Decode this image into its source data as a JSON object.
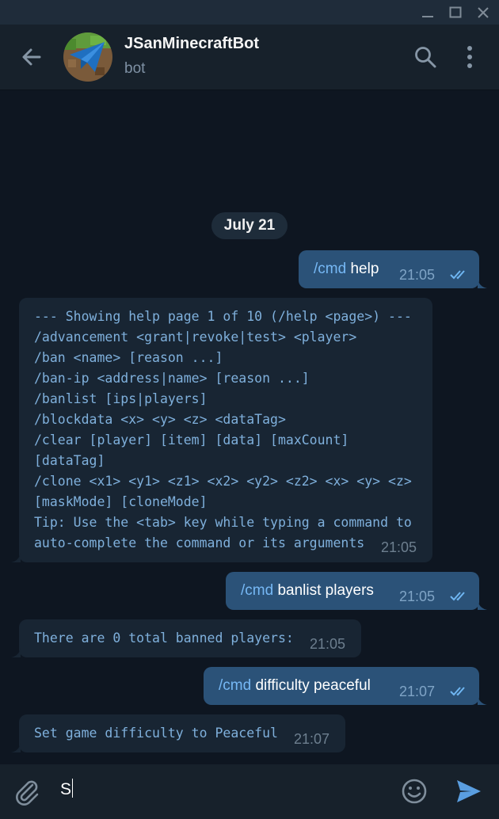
{
  "header": {
    "title": "JSanMinecraftBot",
    "status": "bot"
  },
  "date_separator": "July 21",
  "messages": [
    {
      "direction": "out",
      "command": "/cmd",
      "text": "help",
      "time": "21:05"
    },
    {
      "direction": "in",
      "lines": [
        "--- Showing help page 1 of 10 (/help <page>) ---",
        "/advancement <grant|revoke|test> <player>",
        "/ban <name> [reason ...]",
        "/ban-ip <address|name> [reason ...]",
        "/banlist [ips|players]",
        "/blockdata <x> <y> <z> <dataTag>",
        "/clear [player] [item] [data] [maxCount]",
        "[dataTag]",
        "/clone <x1> <y1> <z1> <x2> <y2> <z2> <x> <y> <z>",
        "[maskMode] [cloneMode]",
        "Tip: Use the <tab> key while typing a command to",
        "auto-complete the command or its arguments"
      ],
      "time": "21:05"
    },
    {
      "direction": "out",
      "command": "/cmd",
      "text": "banlist players",
      "time": "21:05"
    },
    {
      "direction": "in",
      "lines": [
        "There are 0 total banned players:"
      ],
      "time": "21:05"
    },
    {
      "direction": "out",
      "command": "/cmd",
      "text": "difficulty peaceful",
      "time": "21:07"
    },
    {
      "direction": "in",
      "lines": [
        "Set game difficulty to Peaceful"
      ],
      "time": "21:07"
    }
  ],
  "composer": {
    "value": "S"
  },
  "icons": {
    "titlebar": [
      "minimize-icon",
      "maximize-icon",
      "close-icon"
    ],
    "header": [
      "back-arrow-icon",
      "bot-avatar",
      "search-icon",
      "more-vert-icon"
    ],
    "composer": [
      "paperclip-icon",
      "emoji-icon",
      "send-icon"
    ],
    "status": "double-check-icon"
  },
  "colors": {
    "background": "#0e1621",
    "header": "#17212b",
    "outgoing_bubble": "#2b5278",
    "incoming_bubble": "#182533",
    "command_link": "#76b8f5",
    "monospace_text": "#7fb0dc",
    "send_accent": "#5a9ee0"
  }
}
